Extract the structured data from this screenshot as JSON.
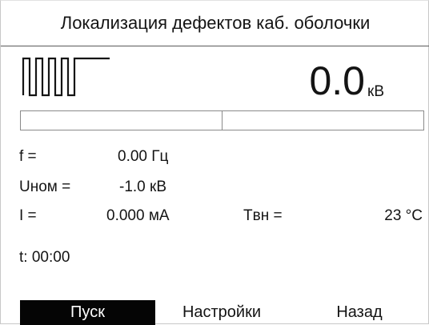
{
  "title": "Локализация дефектов каб. оболочки",
  "waveform_icon": "square-wave-icon",
  "voltage": {
    "value": "0.0",
    "unit": "кВ"
  },
  "progress": {
    "fraction": 0.0,
    "center_marker": 0.5
  },
  "params": {
    "frequency_label": "f =",
    "frequency_value": "0.00 Гц",
    "unom_label": "Uном =",
    "unom_value": "-1.0 кВ",
    "current_label": "I =",
    "current_value": "0.000 мА",
    "tvn_label": "Tвн =",
    "tvn_value": "23 °C"
  },
  "timer": "t: 00:00",
  "buttons": {
    "start": "Пуск",
    "settings": "Настройки",
    "back": "Назад"
  },
  "colors": {
    "active_button_bg": "#050505",
    "active_button_text": "#ffffff",
    "text": "#141414"
  }
}
